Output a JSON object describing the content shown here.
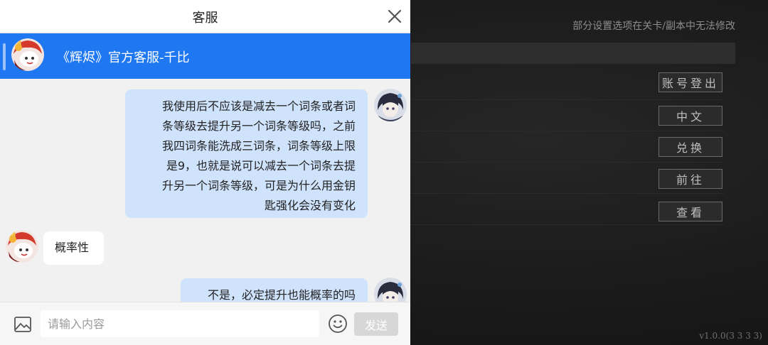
{
  "game": {
    "notice": "部分设置选项在关卡/副本中无法修改",
    "buttons": {
      "account_logout": "账号登出",
      "language": "中文",
      "redeem": "兑换",
      "goto": "前往",
      "view": "查看"
    },
    "version": "v1.0.0(3 3 3 3)"
  },
  "panel": {
    "title": "客服",
    "agent_name": "《辉烬》官方客服-千比"
  },
  "messages": [
    {
      "sender": "user",
      "lines": [
        "我使用后不应该是减去一个词条或者词",
        "条等级去提升另一个词条等级吗，之前",
        "我四词条能洗成三词条，词条等级上限",
        "是9，也就是说可以减去一个词条去提",
        "升另一个词条等级，可是为什么用金钥",
        "匙强化会没有变化"
      ]
    },
    {
      "sender": "agent",
      "text": "概率性"
    },
    {
      "sender": "user",
      "text": "不是，必定提升也能概率的吗"
    }
  ],
  "input": {
    "placeholder": "请输入内容",
    "send_label": "发送"
  },
  "colors": {
    "header_blue": "#1f78f2",
    "user_bubble": "#cfe3fd",
    "send_disabled": "#d7d7d7"
  }
}
